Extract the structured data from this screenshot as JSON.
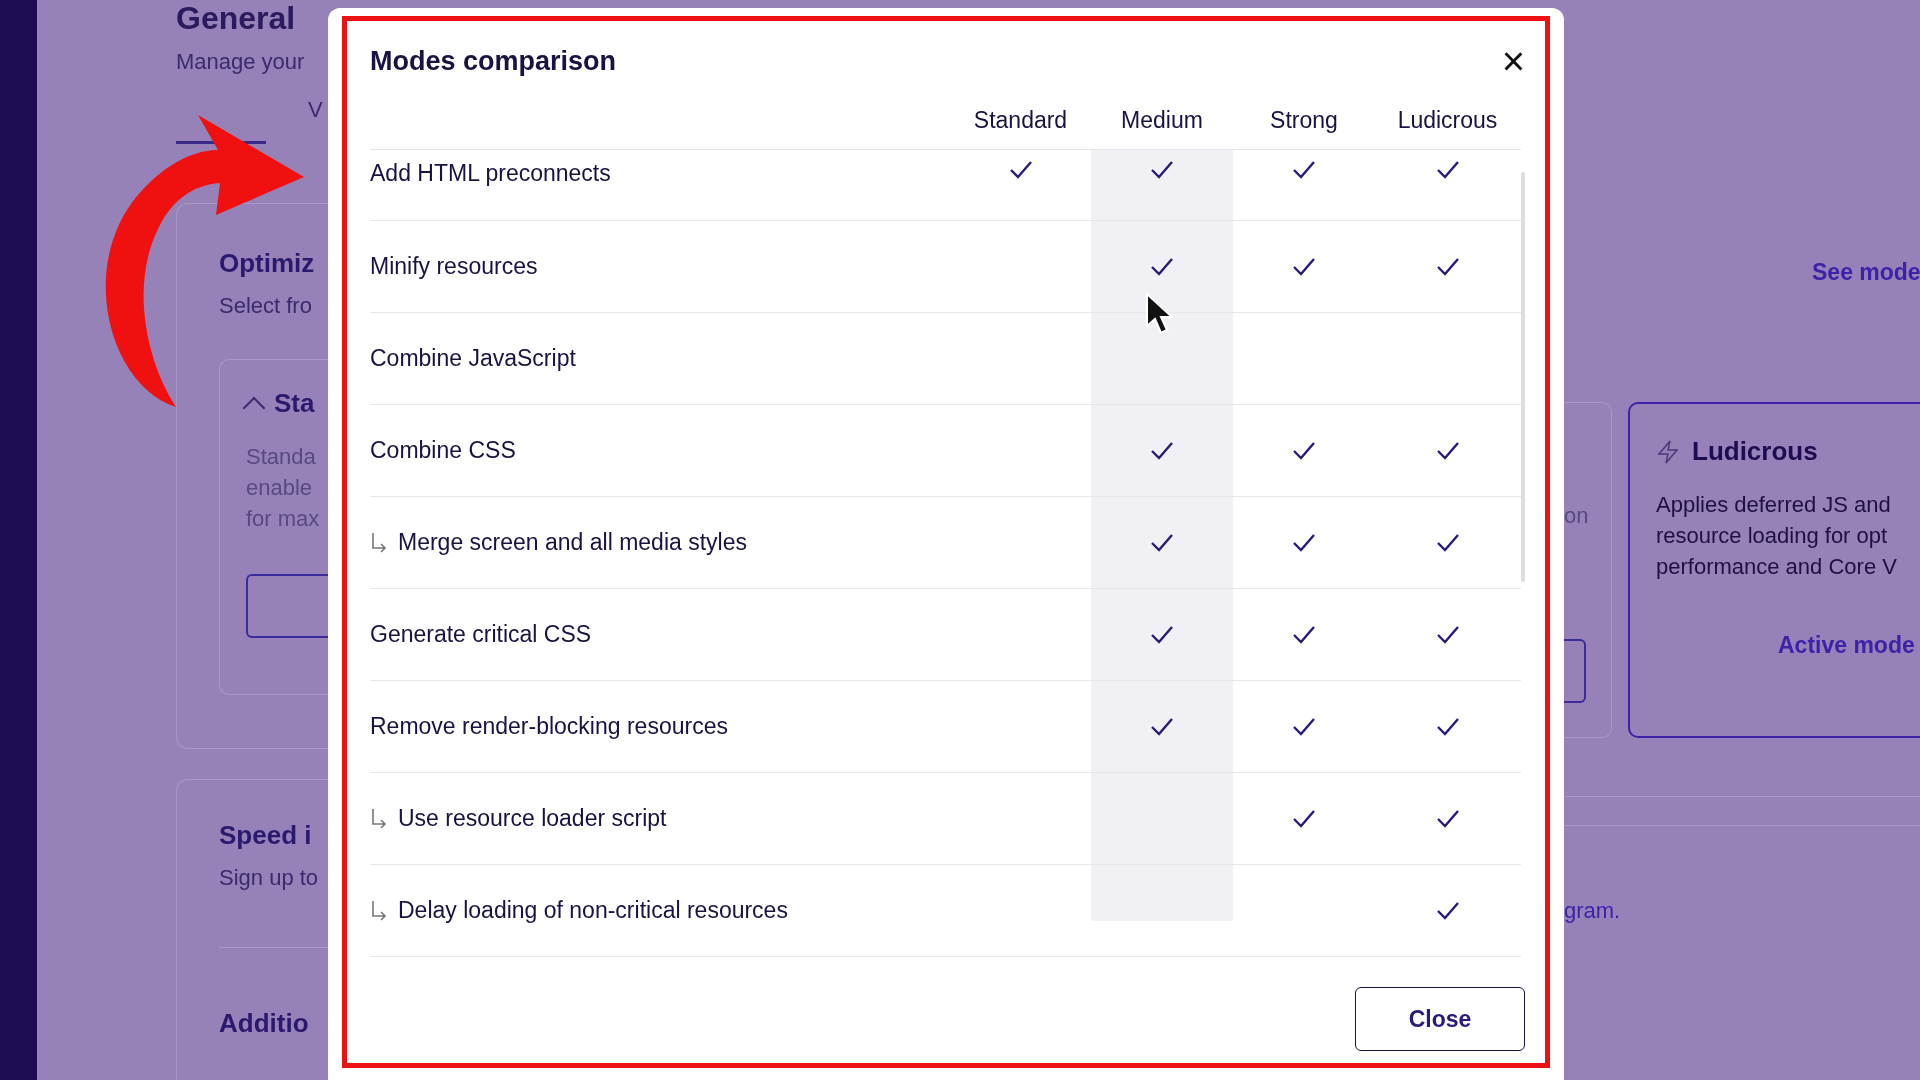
{
  "background": {
    "page_title": "General",
    "page_subtitle": "Manage your",
    "tab": "V",
    "optimization_card": {
      "title": "Optimiz",
      "subtitle": "Select fro",
      "mode_card": {
        "title": "Sta",
        "lines": [
          "Standa",
          "enable",
          "for max"
        ]
      }
    },
    "speed_card": {
      "title": "Speed i",
      "subtitle": "Sign up to"
    },
    "additional_title": "Additio",
    "right": {
      "fragment": "on",
      "see_modes_link": "See mode",
      "ludicrous_card": {
        "title": "Ludicrous",
        "lines": [
          "Applies deferred JS and",
          "resource loading for opt",
          "performance and Core V"
        ],
        "status": "Active mode"
      },
      "link_fragment": "gram."
    }
  },
  "dialog": {
    "title": "Modes comparison",
    "close_icon": "×",
    "columns": [
      {
        "label": "Standard",
        "selected": false
      },
      {
        "label": "Medium",
        "selected": true
      },
      {
        "label": "Strong",
        "selected": false
      },
      {
        "label": "Ludicrous",
        "selected": false
      }
    ],
    "rows": [
      {
        "label": "Add HTML preconnects",
        "kind": "main",
        "values": [
          true,
          true,
          true,
          true
        ]
      },
      {
        "label": "Minify resources",
        "kind": "main",
        "values": [
          false,
          true,
          true,
          true
        ]
      },
      {
        "label": "Combine JavaScript",
        "kind": "main",
        "values": [
          false,
          false,
          false,
          false
        ]
      },
      {
        "label": "Combine CSS",
        "kind": "main",
        "values": [
          false,
          true,
          true,
          true
        ]
      },
      {
        "label": "Merge screen and all media styles",
        "kind": "sub",
        "values": [
          false,
          true,
          true,
          true
        ]
      },
      {
        "label": "Generate critical CSS",
        "kind": "main",
        "values": [
          false,
          true,
          true,
          true
        ]
      },
      {
        "label": "Remove render-blocking resources",
        "kind": "main",
        "values": [
          false,
          true,
          true,
          true
        ]
      },
      {
        "label": "Use resource loader script",
        "kind": "sub",
        "values": [
          false,
          false,
          true,
          true
        ]
      },
      {
        "label": "Delay loading of non-critical resources",
        "kind": "sub",
        "values": [
          false,
          false,
          false,
          true
        ]
      }
    ],
    "close_button": "Close"
  }
}
